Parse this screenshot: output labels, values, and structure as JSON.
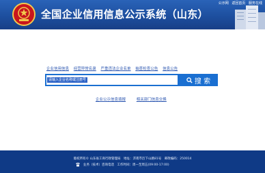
{
  "header": {
    "title": "全国企业信用信息公示系统（山东）",
    "top_links": [
      "公示网",
      "返回首页",
      "服务在线"
    ],
    "emblem_icon": "national-emblem-icon",
    "colors": {
      "header_blue": "#1d4f9f",
      "emblem_red": "#c8161d",
      "emblem_gold": "#f2c94c"
    }
  },
  "nav": {
    "items": [
      "企业信用信息",
      "经营异常名录",
      "严重违法企业名单",
      "抽查检查公告",
      "信息公告"
    ]
  },
  "search": {
    "placeholder": "请输入企业名称或注册号",
    "button_label": "搜 索",
    "accent": "#1a6fd1"
  },
  "sub_links": [
    "企业公示信息填报",
    "相关部门信息交换"
  ],
  "footer": {
    "line1": "版权所有© 山东省工商行政管理局　地址：济南市历下山路81号　邮政编码：250014",
    "line2": "业务（技术）咨询电话　工作时间：周一至周五(09:00-17:00)",
    "phone_icon": "phone-icon",
    "color": "#0f3a86"
  }
}
